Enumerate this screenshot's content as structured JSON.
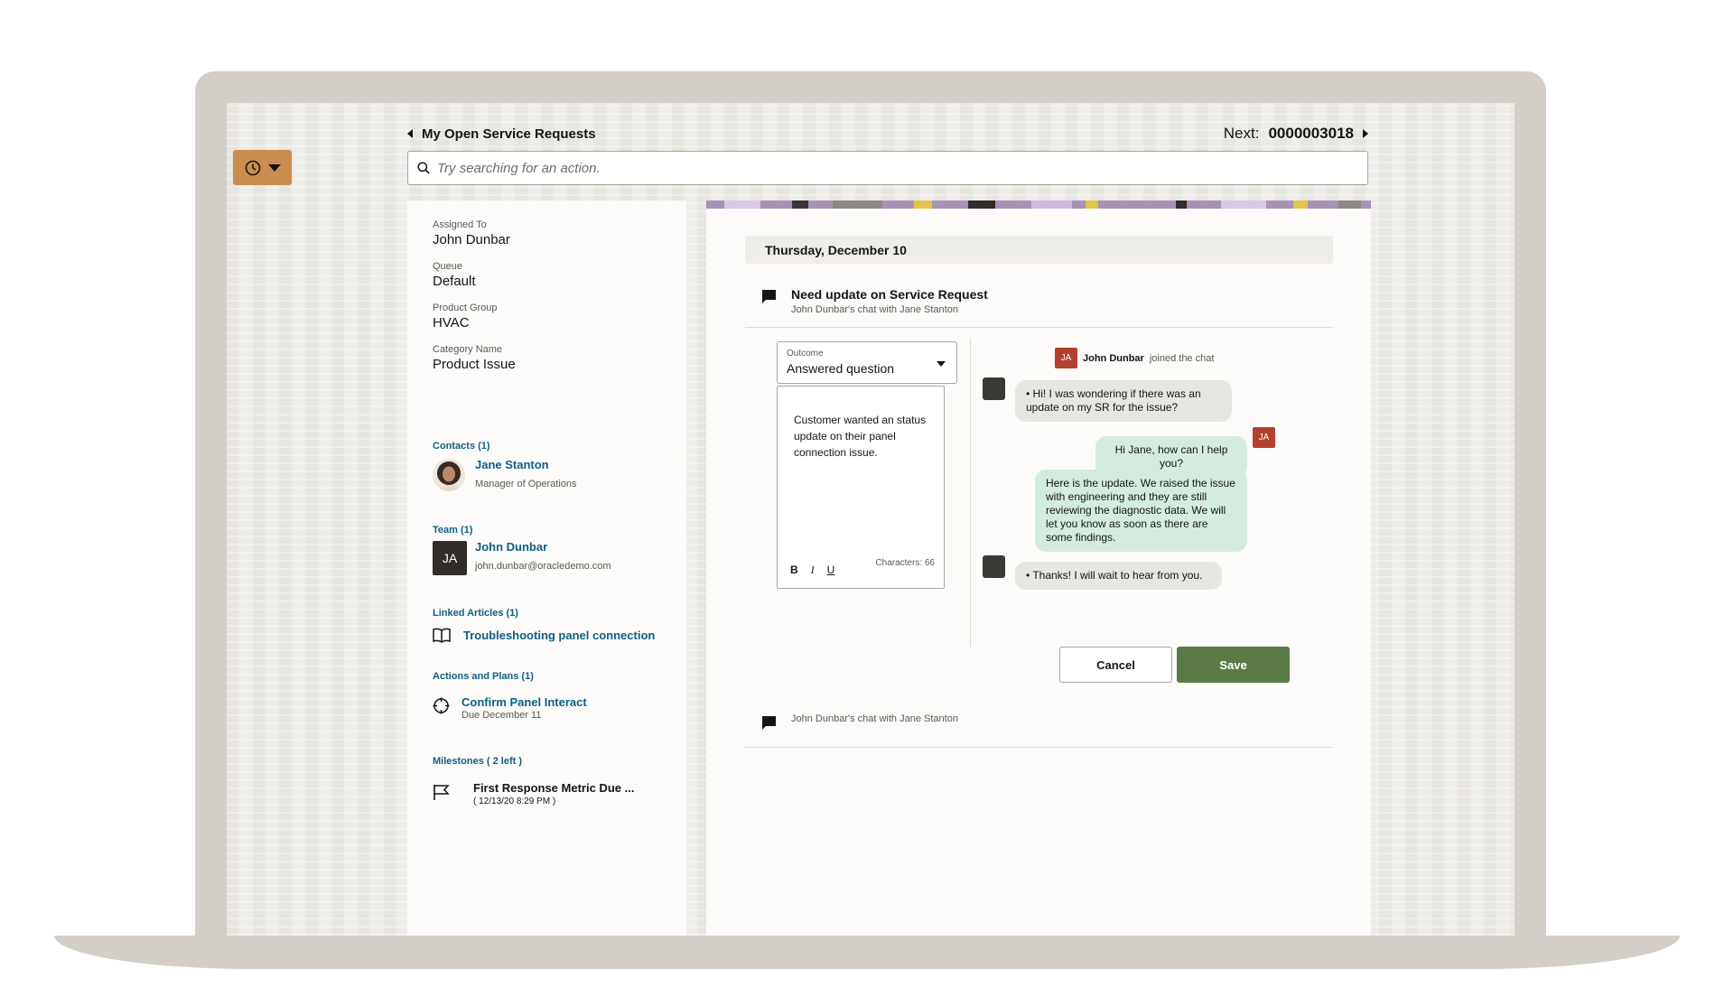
{
  "header": {
    "back_label": "My Open Service Requests",
    "next_label": "Next:",
    "next_number": "0000003018"
  },
  "search": {
    "placeholder": "Try searching for an action."
  },
  "details": {
    "assigned_to": {
      "label": "Assigned To",
      "value": "John Dunbar"
    },
    "queue": {
      "label": "Queue",
      "value": "Default"
    },
    "product_group": {
      "label": "Product Group",
      "value": "HVAC"
    },
    "category_name": {
      "label": "Category Name",
      "value": "Product Issue"
    }
  },
  "contacts": {
    "title": "Contacts (1)",
    "items": [
      {
        "name": "Jane Stanton",
        "role": "Manager of Operations"
      }
    ]
  },
  "team": {
    "title": "Team (1)",
    "items": [
      {
        "initials": "JA",
        "name": "John Dunbar",
        "email": "john.dunbar@oracledemo.com"
      }
    ]
  },
  "linked_articles": {
    "title": "Linked Articles (1)",
    "items": [
      {
        "title": "Troubleshooting panel connection"
      }
    ]
  },
  "actions_plans": {
    "title": "Actions and Plans (1)",
    "items": [
      {
        "title": "Confirm Panel Interact",
        "due": "Due December 11"
      }
    ]
  },
  "milestones": {
    "title": "Milestones ( 2 left )",
    "items": [
      {
        "title": "First Response Metric Due ...",
        "date": "( 12/13/20 8:29 PM )"
      }
    ]
  },
  "timeline": {
    "date": "Thursday, December 10",
    "conversation": {
      "title": "Need update on Service Request",
      "subtitle": "John Dunbar's chat with Jane Stanton"
    },
    "outcome": {
      "label": "Outcome",
      "value": "Answered question"
    },
    "note": {
      "text": "Customer wanted an status update on their panel connection issue.",
      "characters": "Characters: 66",
      "bold": "B",
      "italic": "I",
      "underline": "U"
    },
    "chat": {
      "join": {
        "initials": "JA",
        "name": "John Dunbar",
        "suffix": "joined the chat"
      },
      "messages": [
        {
          "from": "customer",
          "text": "• Hi! I was wondering if there was an update on my SR for the issue?"
        },
        {
          "from": "agent",
          "initials": "JA",
          "text": "Hi Jane, how can I help you?"
        },
        {
          "from": "agent",
          "text": "Here is the update.  We raised the issue with engineering and they are still reviewing the diagnostic data.  We will let you know as soon as there are some findings."
        },
        {
          "from": "customer",
          "text": "• Thanks! I will wait to hear from you."
        }
      ]
    },
    "buttons": {
      "cancel": "Cancel",
      "save": "Save"
    },
    "footer_conversation": "John Dunbar's chat with Jane Stanton"
  },
  "colors": {
    "recent_button": "#c98d4f",
    "link": "#0f5f82",
    "save_button": "#5a7b46",
    "agent_bubble": "#d4ecde",
    "customer_bubble": "#e8e6e2",
    "agent_badge": "#b3402f"
  },
  "icons": {
    "recent": "clock-icon",
    "search": "search-icon",
    "chat": "chat-bubble-icon",
    "article": "book-icon",
    "action": "target-icon",
    "milestone": "flag-icon"
  }
}
